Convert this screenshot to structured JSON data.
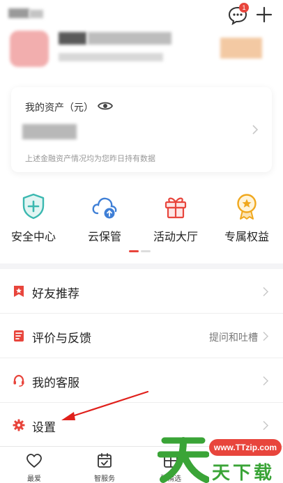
{
  "header": {
    "message_badge": "1"
  },
  "assets": {
    "title": "我的资产（元）",
    "note": "上述金融资产情况均为您昨日持有数据"
  },
  "quick_actions": [
    {
      "label": "安全中心",
      "icon": "shield-icon",
      "color": "#3bb8b0"
    },
    {
      "label": "云保管",
      "icon": "cloud-upload-icon",
      "color": "#3f7fd6"
    },
    {
      "label": "活动大厅",
      "icon": "gift-icon",
      "color": "#e8453c"
    },
    {
      "label": "专属权益",
      "icon": "medal-icon",
      "color": "#f0a81e"
    }
  ],
  "menu": [
    {
      "label": "好友推荐",
      "icon": "bookmark-star-icon",
      "hint": ""
    },
    {
      "label": "评价与反馈",
      "icon": "feedback-icon",
      "hint": "提问和吐槽"
    },
    {
      "label": "我的客服",
      "icon": "headset-icon",
      "hint": ""
    },
    {
      "label": "设置",
      "icon": "gear-icon",
      "hint": ""
    }
  ],
  "bottom_nav": [
    {
      "label": "最爱",
      "icon": "heart-icon"
    },
    {
      "label": "智服务",
      "icon": "calendar-check-icon"
    },
    {
      "label": "慧精选",
      "icon": "grid-icon"
    }
  ],
  "watermark": {
    "url": "www.TTzip.com",
    "text": "天下载"
  },
  "colors": {
    "accent": "#e8453c",
    "brand_green": "#3aa437"
  }
}
